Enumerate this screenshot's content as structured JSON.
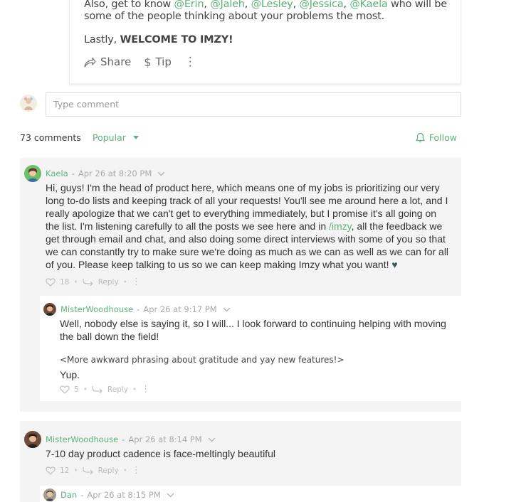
{
  "post": {
    "line1_prefix": "Also, get to know ",
    "mentions": [
      "@Erin",
      "@Jaleh",
      "@Lesley",
      "@Jessica",
      "@Kaela"
    ],
    "line1_suffix": " who will be",
    "line2": "some of the people thinking about your problems the most.",
    "closing_prefix": "Lastly, ",
    "closing_bold": "WELCOME TO IMZY!",
    "share_label": "Share",
    "tip_label": "Tip",
    "more_label": "⋮"
  },
  "comment_input": {
    "placeholder": "Type comment"
  },
  "comments_bar": {
    "count_label": "73 comments",
    "sort_label": "Popular",
    "follow_label": "Follow"
  },
  "comments": [
    {
      "user": "Kaela",
      "time": "Apr 26 at 8:20 PM",
      "body_lines": [
        "Hi, guys! I'm the head of product here, which means one of my jobs is prioritizing our very",
        "long to-do lists and keeping track of all your requests! You'll see me around here a lot, and I",
        "really apologize that we can't get to everything immediately, but I promise it's all going on"
      ],
      "body_line4_prefix": "the list. I'm listening carefully to all the posts we see here and in ",
      "body_line4_link": "/imzy",
      "body_line4_suffix": ", all the feedback we",
      "body_lines_after": [
        "get through email and chat, and also doing some direct interviews with some of you so that",
        "we can constantly try to make sure we're doing as much as we can as well as we can for all"
      ],
      "body_last": "of you. Please keep talking to us so we can keep making Imzy what you want! ",
      "heart_emoji": "♥",
      "likes": "18",
      "reply_label": "Reply",
      "reply": {
        "user": "MisterWoodhouse",
        "time": "Apr 26 at 9:17 PM",
        "body_line1": "Well, nobody else is saying it, so I will... I look forward to continuing helping with moving",
        "body_line2": "the ball down the field!",
        "aside": "<More awkward phrasing about gratitude and yay new features!>",
        "body_line3": "Yup.",
        "likes": "5",
        "reply_label": "Reply"
      }
    },
    {
      "user": "MisterWoodhouse",
      "time": "Apr 26 at 8:14 PM",
      "body": "7-10 day product cadence is face-meltingly beautiful",
      "likes": "12",
      "reply_label": "Reply",
      "reply": {
        "user": "Dan",
        "time": "Apr 26 at 8:15 PM"
      }
    }
  ],
  "colors": {
    "accent": "#5cb279",
    "thread_bg": "#f4f4f4",
    "muted": "#aaaaaa"
  }
}
